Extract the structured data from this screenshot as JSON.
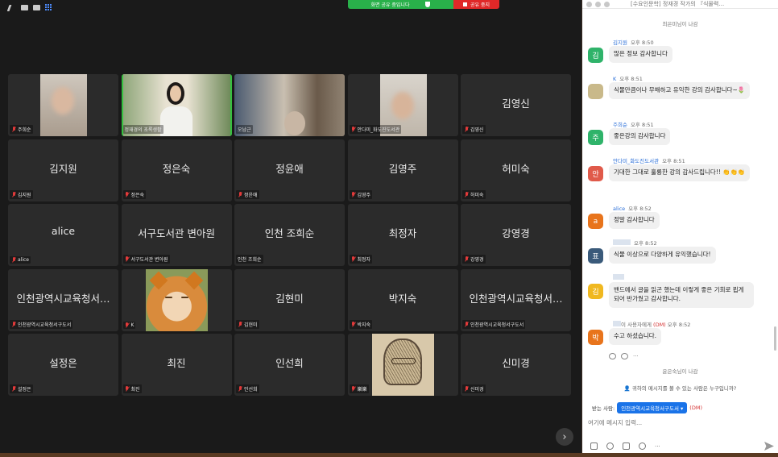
{
  "share_bar": {
    "status_label": "화면 공유 중입니다",
    "stop_label": "공유 중지"
  },
  "tiles": [
    {
      "id": "t1",
      "name": "",
      "label": "주희순",
      "muted": true
    },
    {
      "id": "t2",
      "name": "",
      "label": "정재경의 초록생활",
      "muted": false
    },
    {
      "id": "t3",
      "name": "",
      "label": "오남근",
      "muted": false
    },
    {
      "id": "t4",
      "name": "",
      "label": "안다미_화도진도서관",
      "muted": true
    },
    {
      "id": "t5",
      "name": "김영신",
      "label": "김영신",
      "muted": true
    },
    {
      "id": "t6",
      "name": "김지원",
      "label": "김지원",
      "muted": true
    },
    {
      "id": "t7",
      "name": "정은숙",
      "label": "정은숙",
      "muted": true
    },
    {
      "id": "t8",
      "name": "정윤애",
      "label": "정윤애",
      "muted": true
    },
    {
      "id": "t9",
      "name": "김영주",
      "label": "김영주",
      "muted": true
    },
    {
      "id": "t10",
      "name": "허미숙",
      "label": "허미숙",
      "muted": true
    },
    {
      "id": "t11",
      "name": "alice",
      "label": "alice",
      "muted": true
    },
    {
      "id": "t12",
      "name": "서구도서관 변아원",
      "label": "서구도서관 변아원",
      "muted": true
    },
    {
      "id": "t13",
      "name": "인천 조희순",
      "label": "인천 조희순",
      "muted": false
    },
    {
      "id": "t14",
      "name": "최정자",
      "label": "최정자",
      "muted": true
    },
    {
      "id": "t15",
      "name": "강영경",
      "label": "강영경",
      "muted": true
    },
    {
      "id": "t16",
      "name": "인천광역시교육청서…",
      "label": "인천광역시교육청서구도서",
      "muted": true
    },
    {
      "id": "t17",
      "name": "",
      "label": "K",
      "muted": true
    },
    {
      "id": "t18",
      "name": "김현미",
      "label": "김현미",
      "muted": true
    },
    {
      "id": "t19",
      "name": "박지숙",
      "label": "박지숙",
      "muted": true
    },
    {
      "id": "t20",
      "name": "인천광역시교육청서…",
      "label": "인천광역시교육청서구도서",
      "muted": true
    },
    {
      "id": "t21",
      "name": "설정은",
      "label": "설정은",
      "muted": true
    },
    {
      "id": "t22",
      "name": "최진",
      "label": "최진",
      "muted": true
    },
    {
      "id": "t23",
      "name": "인선희",
      "label": "인선희",
      "muted": true
    },
    {
      "id": "t24",
      "name": "",
      "label": "樂樂",
      "muted": true
    },
    {
      "id": "t25",
      "name": "신미경",
      "label": "신미경",
      "muted": true
    }
  ],
  "chat": {
    "title": "[수요인문학] 정재경 작가의 『식물력…",
    "left_notice_top": "최은미님이 나감",
    "left_notice_bottom": "윤은숙님이 나감",
    "messages": [
      {
        "initial": "김",
        "color": "#2fb36a",
        "sender": "김지원",
        "time": "오후 8:50",
        "text": "많은 정보 감사합니다",
        "dm": ""
      },
      {
        "initial": "",
        "color": "#c9b98a",
        "sender": "K",
        "time": "오후 8:51",
        "text": "식물만큼이나 무해하고 유익한 강의 감사합니다~🌷",
        "dm": ""
      },
      {
        "initial": "주",
        "color": "#2fb36a",
        "sender": "주희순",
        "time": "오후 8:51",
        "text": "좋은강의 감사합니다",
        "dm": ""
      },
      {
        "initial": "안",
        "color": "#e05a4a",
        "sender": "안다미_화도진도서관",
        "time": "오후 8:51",
        "text": "기대한 그대로 훌륭한 강의 감사드립니다!! 👏👏👏",
        "dm": ""
      },
      {
        "initial": "a",
        "color": "#e8741c",
        "sender": "alice",
        "time": "오후 8:52",
        "text": "정말 감사합니다",
        "dm": ""
      },
      {
        "initial": "표",
        "color": "#3a5a7a",
        "sender": "",
        "time": "오후 8:52",
        "text": "식물 이상으로 다양하게 유익했습니다!",
        "dm": ""
      },
      {
        "initial": "김",
        "color": "#f0b820",
        "sender": "",
        "time": "오후 8:52",
        "text": "밴드에서 글을 읽곤 했는데 이렇게 좋은 기회로 뵙게 되어 반가웠고 감사합니다.",
        "dm": ""
      },
      {
        "initial": "박",
        "color": "#e8741c",
        "sender": "",
        "time": "오후 8:52",
        "text": "수고 하셨습니다.",
        "dm": "(DM)",
        "to": "이 사용자에게"
      }
    ],
    "who_can_see": "귀하의 메시지를 볼 수 있는 사람은 누구입니까?",
    "send_to_label": "받는 사람:",
    "recipient": "인천광역시교육청서구도서",
    "recipient_dm": "(DM)",
    "input_placeholder": "여기에 메시지 입력..."
  }
}
